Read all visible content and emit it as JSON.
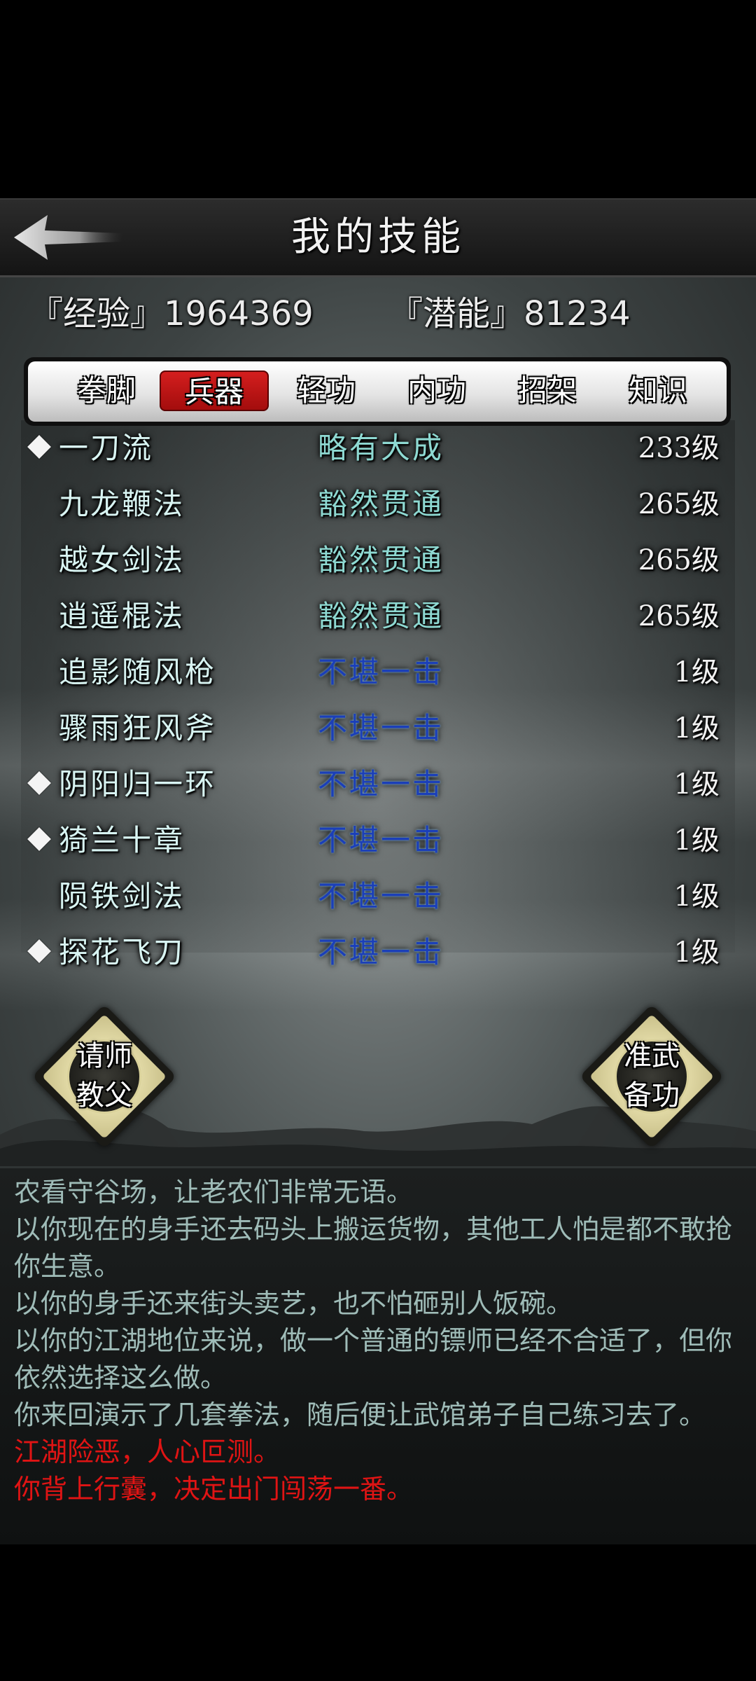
{
  "header": {
    "title": "我的技能",
    "back_icon": "arrow-left-icon"
  },
  "stats": {
    "experience_label": "『经验』1964369",
    "potential_label": "『潜能』81234"
  },
  "tabs": [
    {
      "label": "拳脚",
      "active": false
    },
    {
      "label": "兵器",
      "active": true
    },
    {
      "label": "轻功",
      "active": false
    },
    {
      "label": "内功",
      "active": false
    },
    {
      "label": "招架",
      "active": false
    },
    {
      "label": "知识",
      "active": false
    }
  ],
  "skills": [
    {
      "name": "一刀流",
      "rank": "略有大成",
      "level": "233级",
      "marked": true,
      "tier": "high"
    },
    {
      "name": "九龙鞭法",
      "rank": "豁然贯通",
      "level": "265级",
      "marked": false,
      "tier": "high"
    },
    {
      "name": "越女剑法",
      "rank": "豁然贯通",
      "level": "265级",
      "marked": false,
      "tier": "high"
    },
    {
      "name": "逍遥棍法",
      "rank": "豁然贯通",
      "level": "265级",
      "marked": false,
      "tier": "high"
    },
    {
      "name": "追影随风枪",
      "rank": "不堪一击",
      "level": "1级",
      "marked": false,
      "tier": "low"
    },
    {
      "name": "骤雨狂风斧",
      "rank": "不堪一击",
      "level": "1级",
      "marked": false,
      "tier": "low"
    },
    {
      "name": "阴阳归一环",
      "rank": "不堪一击",
      "level": "1级",
      "marked": true,
      "tier": "low"
    },
    {
      "name": "猗兰十章",
      "rank": "不堪一击",
      "level": "1级",
      "marked": true,
      "tier": "low"
    },
    {
      "name": "陨铁剑法",
      "rank": "不堪一击",
      "level": "1级",
      "marked": false,
      "tier": "low"
    },
    {
      "name": "探花飞刀",
      "rank": "不堪一击",
      "level": "1级",
      "marked": true,
      "tier": "low"
    }
  ],
  "buttons": {
    "ask_master_line1": "请师",
    "ask_master_line2": "教父",
    "prepare_line1": "准武",
    "prepare_line2": "备功"
  },
  "log": [
    {
      "text": "农看守谷场，让老农们非常无语。",
      "color": "normal"
    },
    {
      "text": "以你现在的身手还去码头上搬运货物，其他工人怕是都不敢抢你生意。",
      "color": "normal"
    },
    {
      "text": "以你的身手还来街头卖艺，也不怕砸别人饭碗。",
      "color": "normal"
    },
    {
      "text": "以你的江湖地位来说，做一个普通的镖师已经不合适了，但你依然选择这么做。",
      "color": "normal"
    },
    {
      "text": "你来回演示了几套拳法，随后便让武馆弟子自己练习去了。",
      "color": "normal"
    },
    {
      "text": "江湖险恶，人心叵测。",
      "color": "red"
    },
    {
      "text": "你背上行囊，决定出门闯荡一番。",
      "color": "red"
    }
  ],
  "colors": {
    "active_tab": "#c41515",
    "rank_high": "#8ed9d2",
    "rank_low": "#1b3fb8",
    "log_text": "#9fbcb8",
    "log_alert": "#e01414"
  }
}
